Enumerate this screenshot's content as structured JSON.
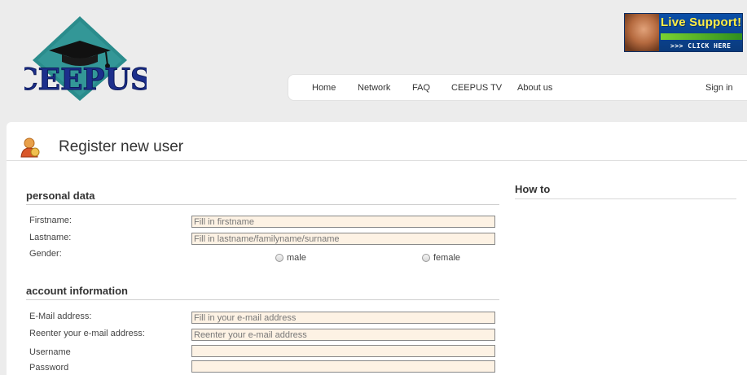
{
  "header": {
    "logo_text": "CEEPUS",
    "live_support": {
      "title": "Live Support!",
      "cta": ">>> CLICK HERE"
    },
    "nav": [
      {
        "label": "Home"
      },
      {
        "label": "Network"
      },
      {
        "label": "FAQ"
      },
      {
        "label": "CEEPUS TV"
      },
      {
        "label": "About us"
      },
      {
        "label": "Sign in"
      }
    ]
  },
  "page": {
    "title": "Register new user",
    "title_icon": "user-icon"
  },
  "personal": {
    "heading": "personal data",
    "firstname": {
      "label": "Firstname:",
      "placeholder": "Fill in firstname",
      "value": ""
    },
    "lastname": {
      "label": "Lastname:",
      "placeholder": "Fill in lastname/familyname/surname",
      "value": ""
    },
    "gender": {
      "label": "Gender:",
      "options": [
        "male",
        "female"
      ]
    }
  },
  "account": {
    "heading": "account information",
    "email": {
      "label": "E-Mail address:",
      "placeholder": "Fill in your e-mail address",
      "value": ""
    },
    "email_confirm": {
      "label": "Reenter your e-mail address:",
      "placeholder": "Reenter your e-mail address",
      "value": ""
    },
    "username": {
      "label": "Username",
      "placeholder": "",
      "value": ""
    },
    "password": {
      "label": "Password",
      "placeholder": "",
      "value": ""
    }
  },
  "sidebar": {
    "howto_heading": "How to"
  },
  "colors": {
    "input_bg": "#fdf2e4",
    "logo_diamond": "#2a8c8c",
    "logo_text": "#1c2f8c"
  }
}
